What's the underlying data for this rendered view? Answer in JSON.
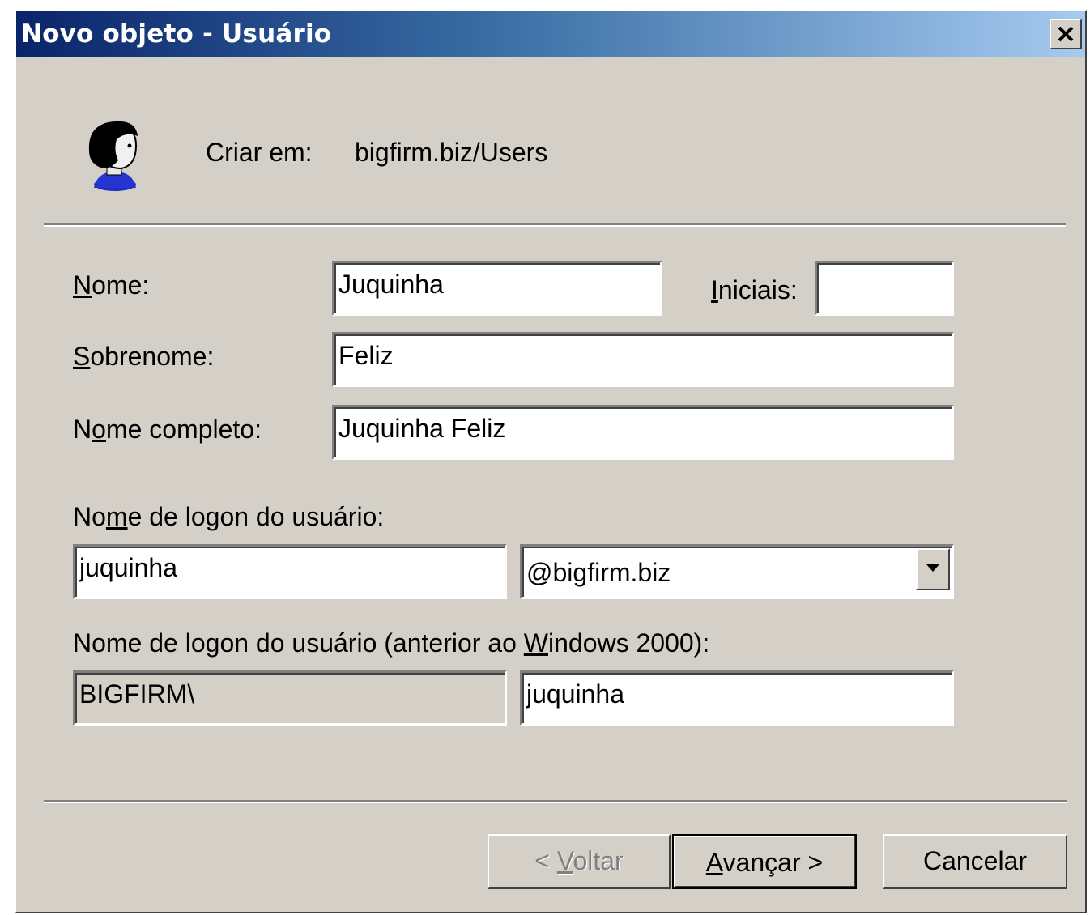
{
  "window": {
    "title": "Novo objeto - Usuário"
  },
  "icons": {
    "user": "user-icon",
    "close": "close-icon",
    "dropdown": "chevron-down-icon"
  },
  "header": {
    "create_in_label": "Criar em:",
    "create_in_value": "bigfirm.biz/Users"
  },
  "form": {
    "first_name": {
      "label_pre": "",
      "label_key": "N",
      "label_post": "ome:",
      "value": "Juquinha"
    },
    "initials": {
      "label_pre": "",
      "label_key": "I",
      "label_post": "niciais:",
      "value": ""
    },
    "last_name": {
      "label_pre": "",
      "label_key": "S",
      "label_post": "obrenome:",
      "value": "Feliz"
    },
    "full_name": {
      "label_pre": "N",
      "label_key": "o",
      "label_post": "me completo:",
      "value": "Juquinha Feliz"
    },
    "logon_name": {
      "label_pre": "No",
      "label_key": "m",
      "label_post": "e de logon do usuário:",
      "value": "juquinha",
      "domain_selected": "@bigfirm.biz"
    },
    "pre2000_logon": {
      "label_pre": "Nome de logon do usuário (anterior ao ",
      "label_key": "W",
      "label_post": "indows 2000):",
      "domain_prefix": "BIGFIRM\\",
      "value": "juquinha"
    }
  },
  "buttons": {
    "back": {
      "pre": "< ",
      "key": "V",
      "post": "oltar",
      "enabled": false
    },
    "next": {
      "pre": "",
      "key": "A",
      "post": "vançar >",
      "enabled": true
    },
    "cancel": {
      "label": "Cancelar",
      "enabled": true
    }
  }
}
